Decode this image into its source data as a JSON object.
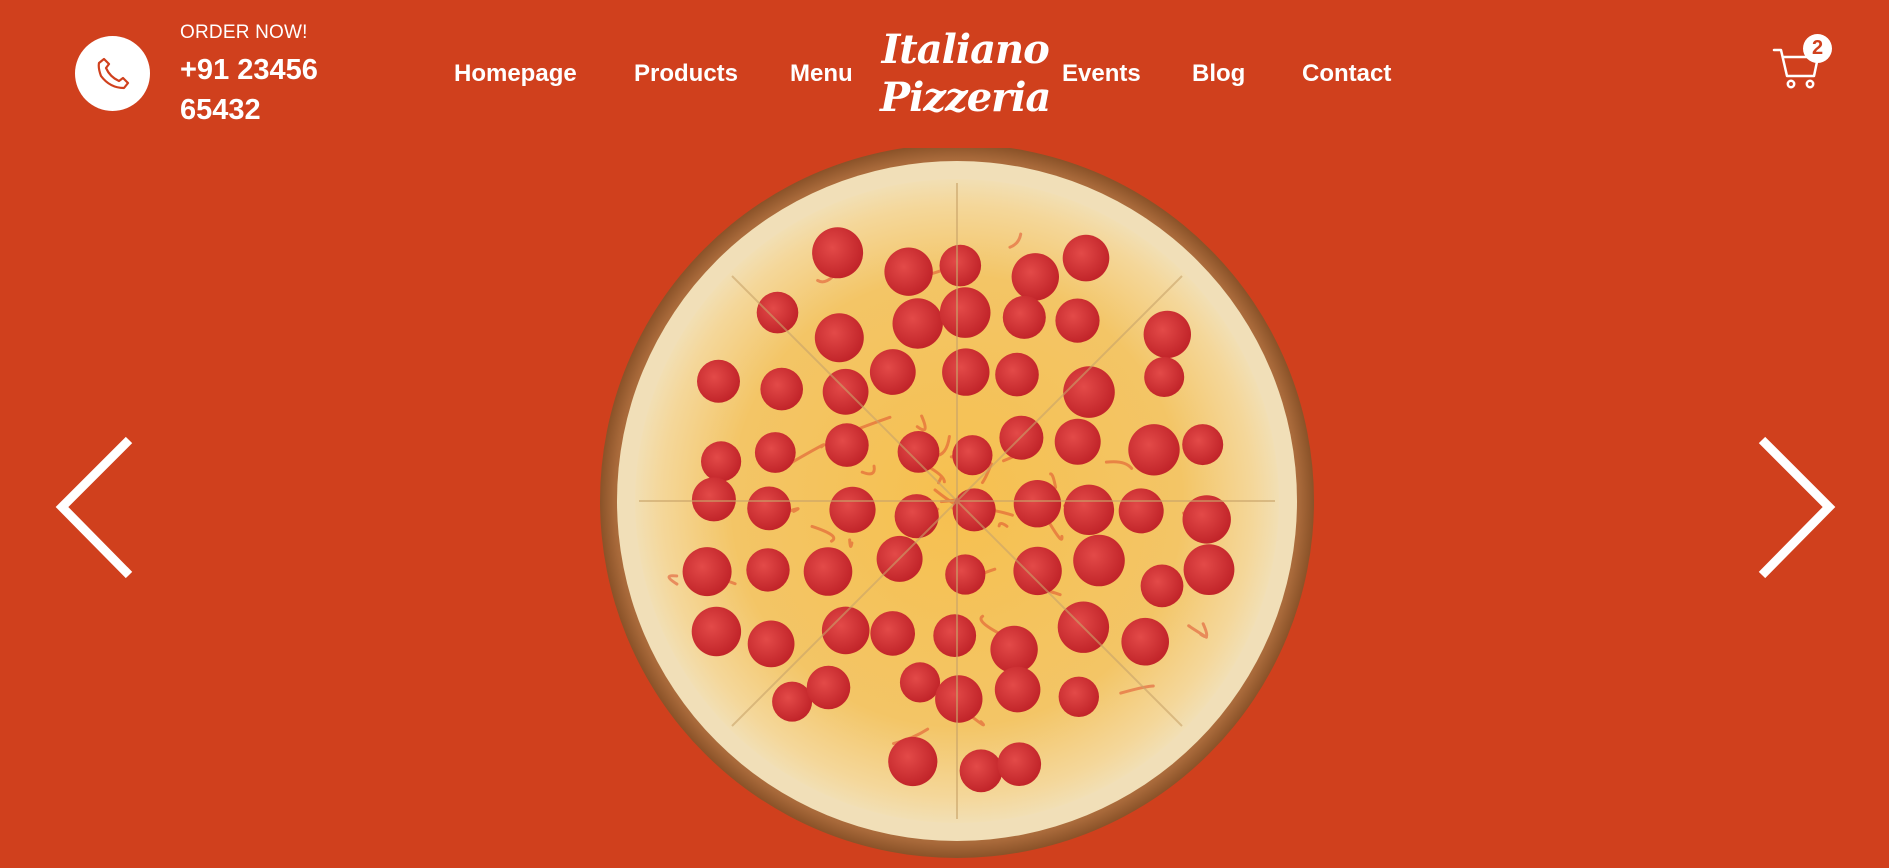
{
  "header": {
    "order_label": "ORDER NOW!",
    "phone_number": "+91 23456 65432",
    "logo_line1": "Italiano",
    "logo_line2": "Pizzeria",
    "nav_left": [
      "Homepage",
      "Products",
      "Menu"
    ],
    "nav_right": [
      "Events",
      "Blog",
      "Contact"
    ],
    "cart_count": "2"
  },
  "icons": {
    "phone": "phone-icon",
    "cart": "shopping-cart-icon",
    "prev": "chevron-left-icon",
    "next": "chevron-right-icon"
  },
  "colors": {
    "background": "#d0401d",
    "text": "#ffffff"
  }
}
